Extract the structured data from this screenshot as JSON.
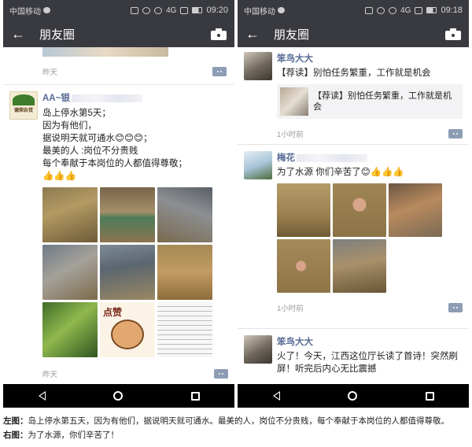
{
  "left_phone": {
    "status": {
      "carrier": "中国移动",
      "signal": "4G",
      "time": "09:20"
    },
    "nav": {
      "title": "朋友圈"
    },
    "prev_post": {
      "time": "昨天"
    },
    "post": {
      "name": "AA~银",
      "avatar_text": "德荣杂货",
      "lines": [
        "岛上停水第5天；",
        "因为有他们，",
        "据说明天就可通水😊😊😊；",
        "最美的人 :岗位不分贵贱",
        "每个奉献于本岗位的人都值得尊敬；",
        "👍👍👍"
      ],
      "sticker_text": "点赞",
      "time": "昨天"
    }
  },
  "right_phone": {
    "status": {
      "carrier": "中国移动",
      "signal": "4G",
      "time": "09:18"
    },
    "nav": {
      "title": "朋友圈"
    },
    "post1": {
      "name": "笨鸟大大",
      "text": "【荐读】别怕任务繁重，工作就是机会",
      "share_title": "【荐读】别怕任务繁重，工作就是机会",
      "time": "1小时前"
    },
    "post2": {
      "name": "梅花",
      "text": "为了水源 你们辛苦了😊👍👍👍",
      "time": "1小时前"
    },
    "post3": {
      "name": "笨鸟大大",
      "text": "火了！今天，江西这位厅长读了首诗！突然刷屏！听完后内心无比震撼"
    }
  },
  "caption": {
    "left_label": "左图：",
    "left_text": "岛上停水第五天，因为有他们，据说明天就可通水。最美的人，岗位不分贵贱，每个奉献于本岗位的人都值得尊敬。",
    "right_label": "右图：",
    "right_text": "为了水源，你们辛苦了！"
  },
  "colors": {
    "bar": "#393a3f",
    "name": "#576b95",
    "mud": "#9c8150",
    "comment_button": "#8c9db5"
  },
  "icons": [
    "back-arrow-icon",
    "camera-icon",
    "comment-dots-icon",
    "nav-back-icon",
    "nav-home-icon",
    "nav-recent-icon"
  ]
}
